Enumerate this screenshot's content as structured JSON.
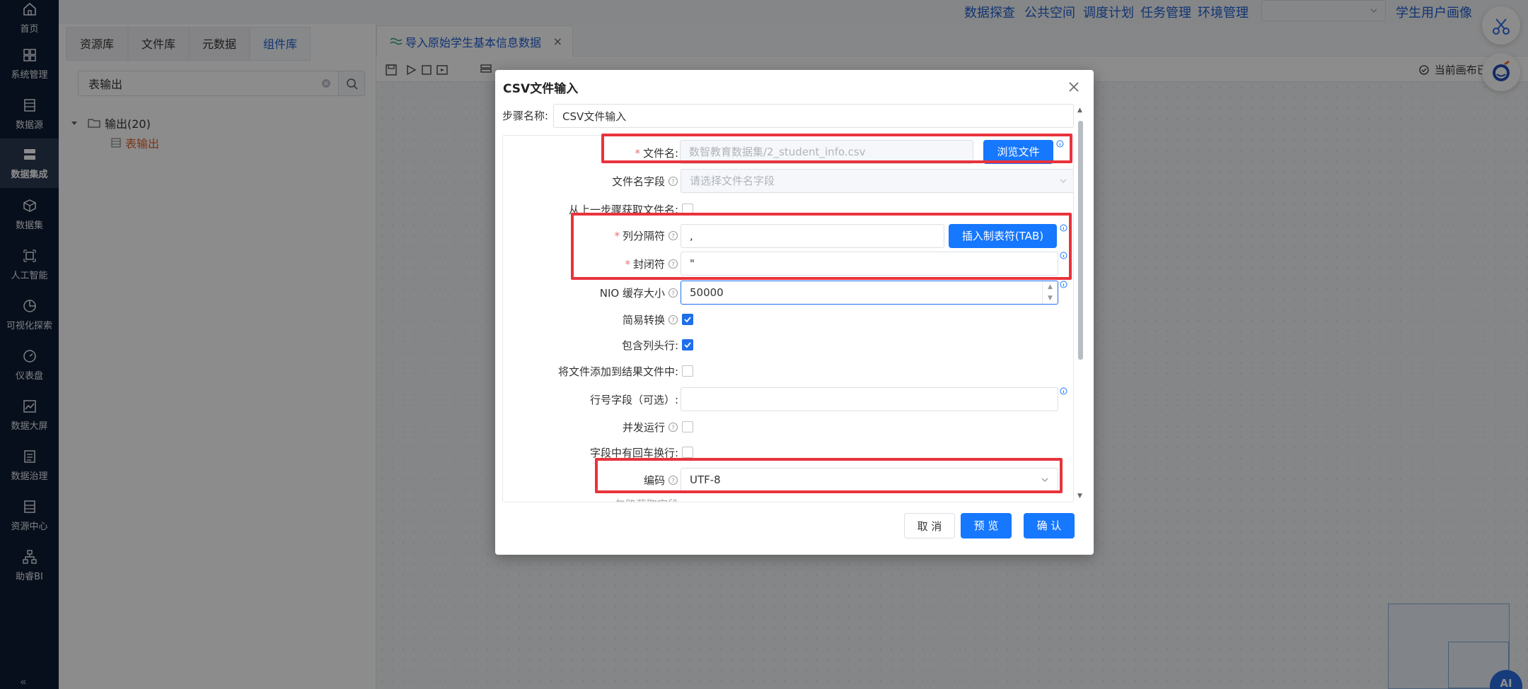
{
  "nav": {
    "items": [
      {
        "label": "首页",
        "icon": "home-icon"
      },
      {
        "label": "系统管理",
        "icon": "grid-icon"
      },
      {
        "label": "数据源",
        "icon": "database-icon"
      },
      {
        "label": "数据集成",
        "icon": "server-stack-icon"
      },
      {
        "label": "数据集",
        "icon": "cube-icon"
      },
      {
        "label": "人工智能",
        "icon": "ai-chip-icon"
      },
      {
        "label": "可视化探索",
        "icon": "pie-chart-icon"
      },
      {
        "label": "仪表盘",
        "icon": "gauge-icon"
      },
      {
        "label": "数据大屏",
        "icon": "line-chart-icon"
      },
      {
        "label": "数据治理",
        "icon": "list-doc-icon"
      },
      {
        "label": "资源中心",
        "icon": "folder-list-icon"
      },
      {
        "label": "助睿BI",
        "icon": "org-chart-icon"
      }
    ],
    "active_index": 3,
    "collapse_glyph": "«"
  },
  "topbar": {
    "links": [
      "数据探查",
      "公共空间",
      "调度计划",
      "任务管理",
      "环境管理"
    ],
    "profile_label": "学生用户画像"
  },
  "resource_panel": {
    "tabs": [
      "资源库",
      "文件库",
      "元数据",
      "组件库"
    ],
    "active_tab": 3,
    "search_value": "表输出",
    "tree": {
      "folder_label": "输出(20)",
      "item_label": "表输出"
    }
  },
  "editor": {
    "tab_title": "导入原始学生基本信息数据",
    "tab_close": "×",
    "canvas_status": "当前画布已"
  },
  "dialog": {
    "title": "CSV文件输入",
    "step_name_label": "步骤名称:",
    "step_name_value": "CSV文件输入",
    "fields": {
      "filename_label": "文件名:",
      "filename_value": "数智教育数据集/2_student_info.csv",
      "browse_label": "浏览文件",
      "filename_field_label": "文件名字段",
      "filename_field_placeholder": "请选择文件名字段",
      "from_prev_label": "从上一步骤获取文件名:",
      "delimiter_label": "列分隔符",
      "delimiter_value": ",",
      "insert_tab_label": "插入制表符(TAB)",
      "enclosure_label": "封闭符",
      "enclosure_value": "\"",
      "nio_label": "NIO 缓存大小",
      "nio_value": "50000",
      "lazy_label": "简易转换",
      "lazy_checked": true,
      "header_label": "包含列头行:",
      "header_checked": true,
      "add_result_label": "将文件添加到结果文件中:",
      "add_result_checked": false,
      "rownum_label": "行号字段（可选）:",
      "rownum_value": "",
      "parallel_label": "并发运行",
      "parallel_checked": false,
      "newline_label": "字段中有回车换行:",
      "newline_checked": false,
      "encoding_label": "编码",
      "encoding_value": "UTF-8",
      "cut_label": "包路获取字段"
    },
    "buttons": {
      "cancel": "取 消",
      "preview": "预 览",
      "confirm": "确 认"
    }
  },
  "colors": {
    "primary": "#1677ff",
    "highlight": "#e8333c",
    "sidebar_bg": "#0f1d33",
    "required": "#f56c6c"
  },
  "floating": {
    "ai_label": "AI"
  }
}
